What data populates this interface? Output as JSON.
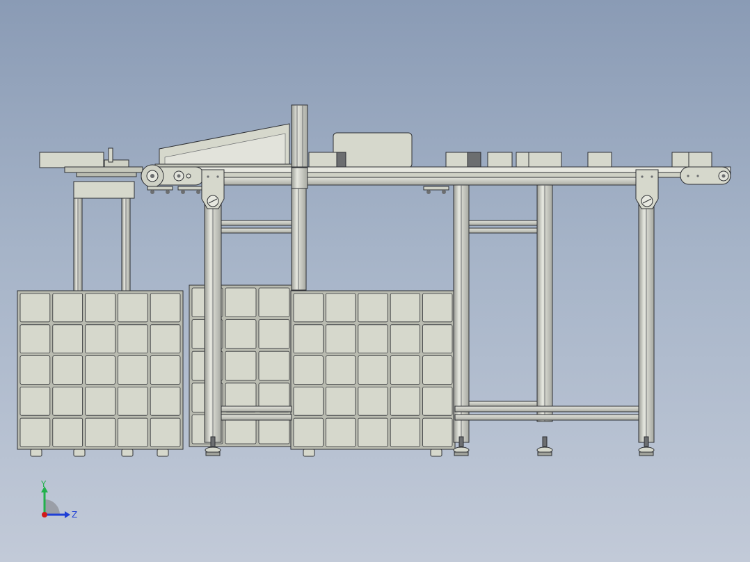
{
  "view": {
    "background_top": "#8a9bb5",
    "background_bottom": "#c2cad8",
    "part_fill": "#d6d8cc",
    "part_fill_dark": "#b9bbb0",
    "outline": "#2d2f33",
    "accent_dark": "#6c6e70"
  },
  "machine": {
    "box_stack_columns": 5,
    "box_stack_rows": 5,
    "conveyor_feet": 6
  },
  "triad": {
    "y_axis": {
      "label": "Y",
      "color": "#22b14c"
    },
    "z_axis": {
      "label": "Z",
      "color": "#1f3fd6"
    },
    "origin_color": "#d11a1a"
  }
}
